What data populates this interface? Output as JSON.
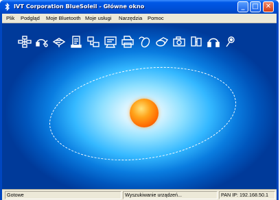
{
  "window": {
    "title": "IVT Corporation BlueSoleil - Główne okno",
    "minimize_label": "_",
    "maximize_label": "□",
    "close_label": "✕"
  },
  "menu": {
    "items": [
      "Plik",
      "Podgląd",
      "Moje Bluetooth",
      "Moje usługi",
      "Narzędzia",
      "Pomoc"
    ]
  },
  "toolbar": {
    "icons": [
      "network-icon",
      "headset-audio-icon",
      "fax-icon",
      "file-transfer-icon",
      "network-access-icon",
      "serial-port-icon",
      "printer-icon",
      "hid-mouse-icon",
      "dialup-icon",
      "camera-icon",
      "pan-icon",
      "headphones-icon",
      "sync-icon"
    ]
  },
  "status": {
    "left": "Gotowe",
    "middle": "Wyszukiwanie urządzeń...",
    "right": "PAN IP: 192.168.50.1"
  },
  "colors": {
    "titlebar": "#0058e6",
    "menubar": "#ece9d8",
    "background_outer": "#003a9a",
    "background_center": "#ffffff",
    "sun_core": "#ff6a00"
  }
}
